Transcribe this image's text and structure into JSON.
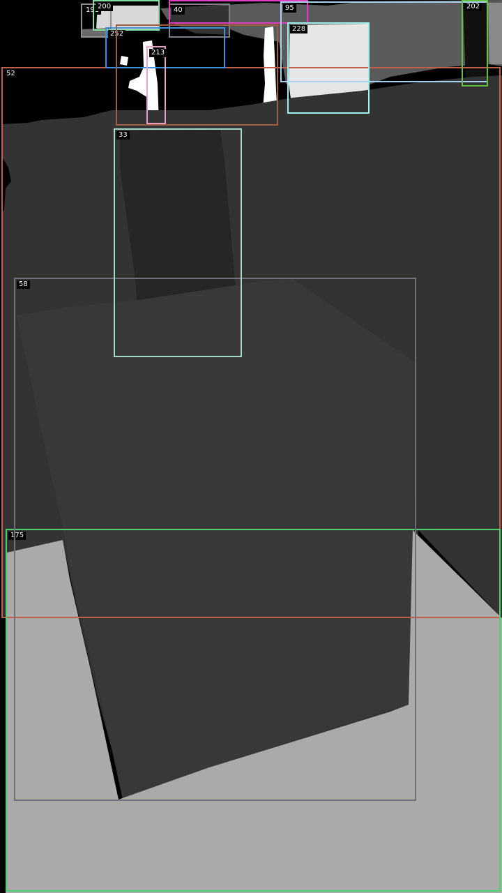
{
  "colors": {
    "background": "#000000",
    "label_background": "#000000",
    "label_text": "#ffffff"
  },
  "regions": [
    {
      "id": "52",
      "label": "52",
      "color": "#c0604a"
    },
    {
      "id": "175",
      "label": "175",
      "color": "#50d070"
    },
    {
      "id": "58",
      "label": "58",
      "color": "#70707a"
    },
    {
      "id": "33",
      "label": "33",
      "color": "#a8d8c8"
    },
    {
      "id": "191",
      "label": "191",
      "color": "#909090"
    },
    {
      "id": "200",
      "label": "200",
      "color": "#80e0a0"
    },
    {
      "id": "40",
      "label": "40",
      "color": "#808088"
    },
    {
      "id": "pink-frame",
      "label": "",
      "color": "#e040c0"
    },
    {
      "id": "252",
      "label": "252",
      "color": "#4090e0"
    },
    {
      "id": "213",
      "label": "213",
      "color": "#e8a0c8"
    },
    {
      "id": "brown-frame",
      "label": "",
      "color": "#a06040"
    },
    {
      "id": "95",
      "label": "95",
      "color": "#a8d0f0"
    },
    {
      "id": "228",
      "label": "228",
      "color": "#a0f0f0"
    },
    {
      "id": "202",
      "label": "202",
      "color": "#60c040"
    }
  ]
}
